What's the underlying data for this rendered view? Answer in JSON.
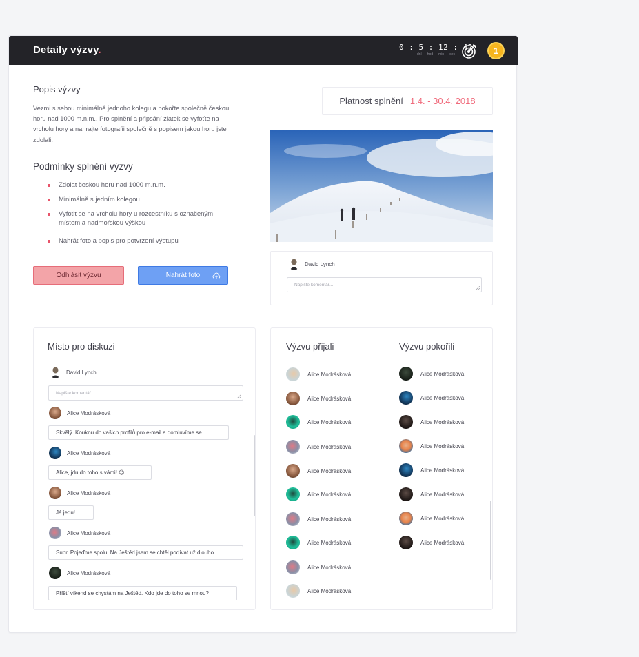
{
  "header": {
    "title": "Detaily výzvy",
    "title_dot": ".",
    "timer": "0 : 5 : 12 : 42",
    "timer_units": [
      "dní",
      "hod",
      "min",
      "sec"
    ],
    "coin_value": "1",
    "target_icon": "target-arrow-icon"
  },
  "description": {
    "heading": "Popis výzvy",
    "text": "Vezmi s sebou minimálně jednoho kolegu a pokořte společně českou horu nad 1000 m.n.m.. Pro splnění a připsání zlatek se vyfoťte na vrcholu hory a nahrajte fotografii společně s popisem  jakou horu jste zdolali."
  },
  "conditions": {
    "heading": "Podmínky splnění výzvy",
    "items": [
      "Zdolat českou horu nad 1000 m.n.m.",
      "Minimálně s jedním kolegou",
      "Vyfotit se na vrcholu hory u rozcestníku s označeným místem a nadmořskou výškou",
      "Nahrát foto a popis pro potvrzení výstupu"
    ]
  },
  "actions": {
    "unsubscribe": "Odhlásit výzvu",
    "upload": "Nahrát foto",
    "upload_icon": "cloud-upload-icon"
  },
  "validity": {
    "label": "Platnost splnění",
    "value": "1.4. - 30.4. 2018"
  },
  "photo_comment": {
    "user": "David Lynch",
    "placeholder": "Napište komentář..."
  },
  "discussion": {
    "heading": "Místo pro diskuzi",
    "user": "David Lynch",
    "placeholder": "Napište komentář...",
    "messages": [
      {
        "author": "Alice Modrásková",
        "text": "Skvělý. Kouknu do vašich profilů pro e-mail a domluvíme se."
      },
      {
        "author": "Alice Modrásková",
        "text": "Alice, jdu do toho s vámi! 😉"
      },
      {
        "author": "Alice Modrásková",
        "text": "Já jedu!"
      },
      {
        "author": "Alice Modrásková",
        "text": "Supr. Pojeďme spolu. Na Ještěd jsem se chtěl podívat už dlouho."
      },
      {
        "author": "Alice Modrásková",
        "text": "Příští víkend se chystám na Ještěd. Kdo jde do toho se mnou?"
      }
    ]
  },
  "accepted": {
    "heading": "Výzvu přijali",
    "users": [
      "Alice Modrásková",
      "Alice Modrásková",
      "Alice Modrásková",
      "Alice Modrásková",
      "Alice Modrásková",
      "Alice Modrásková",
      "Alice Modrásková",
      "Alice Modrásková",
      "Alice Modrásková",
      "Alice Modrásková"
    ]
  },
  "completed": {
    "heading": "Výzvu pokořili",
    "users": [
      "Alice Modrásková",
      "Alice Modrásková",
      "Alice Modrásková",
      "Alice Modrásková",
      "Alice Modrásková",
      "Alice Modrásková",
      "Alice Modrásková",
      "Alice Modrásková"
    ]
  },
  "colors": {
    "accent_red": "#f06b7c",
    "accent_blue": "#6ea0f4",
    "topbar": "#232328",
    "coin": "#f7b51f"
  }
}
